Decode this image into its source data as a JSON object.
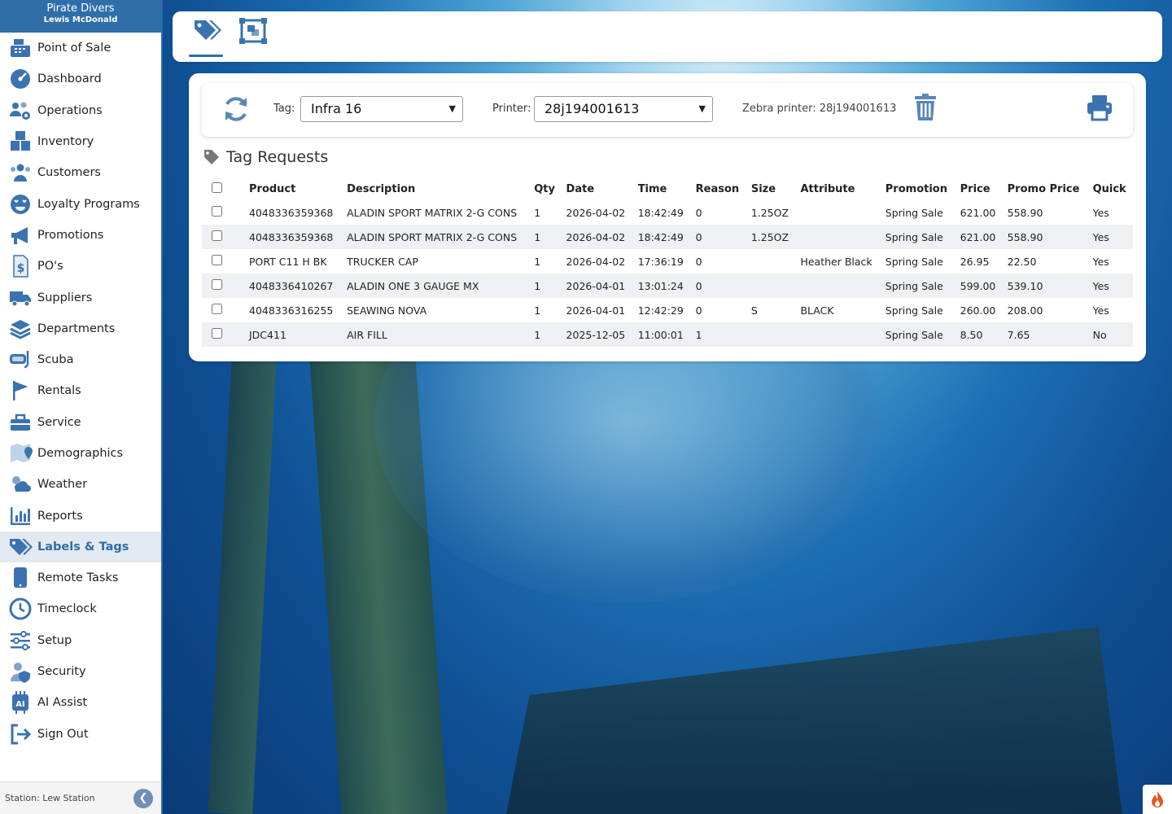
{
  "header": {
    "store": "Pirate Divers",
    "user": "Lewis McDonald"
  },
  "sidebar": {
    "items": [
      {
        "label": "Point of Sale",
        "icon": "cash-register-icon"
      },
      {
        "label": "Dashboard",
        "icon": "gauge-icon"
      },
      {
        "label": "Operations",
        "icon": "users-gear-icon"
      },
      {
        "label": "Inventory",
        "icon": "boxes-icon"
      },
      {
        "label": "Customers",
        "icon": "users-icon"
      },
      {
        "label": "Loyalty Programs",
        "icon": "loyalty-face-icon"
      },
      {
        "label": "Promotions",
        "icon": "megaphone-icon"
      },
      {
        "label": "PO's",
        "icon": "invoice-dollar-icon"
      },
      {
        "label": "Suppliers",
        "icon": "truck-icon"
      },
      {
        "label": "Departments",
        "icon": "layers-icon"
      },
      {
        "label": "Scuba",
        "icon": "mask-icon"
      },
      {
        "label": "Rentals",
        "icon": "flag-icon"
      },
      {
        "label": "Service",
        "icon": "toolbox-icon"
      },
      {
        "label": "Demographics",
        "icon": "map-pin-icon"
      },
      {
        "label": "Weather",
        "icon": "cloud-sun-icon"
      },
      {
        "label": "Reports",
        "icon": "bar-chart-icon"
      },
      {
        "label": "Labels & Tags",
        "icon": "tags-icon",
        "active": true
      },
      {
        "label": "Remote Tasks",
        "icon": "tablet-icon"
      },
      {
        "label": "Timeclock",
        "icon": "clock-icon"
      },
      {
        "label": "Setup",
        "icon": "sliders-icon"
      },
      {
        "label": "Security",
        "icon": "user-shield-icon"
      },
      {
        "label": "AI Assist",
        "icon": "ai-chip-icon"
      },
      {
        "label": "Sign Out",
        "icon": "sign-out-icon"
      }
    ],
    "station": "Station: Lew Station"
  },
  "toolbar": {
    "tabs": [
      {
        "icon": "tag-icon",
        "active": true
      },
      {
        "icon": "label-layout-icon"
      }
    ]
  },
  "controls": {
    "tag_label": "Tag:",
    "tag_value": "Infra 16",
    "printer_label": "Printer:",
    "printer_value": "28j194001613",
    "zebra_text": "Zebra printer: 28j194001613"
  },
  "section": {
    "title": "Tag Requests"
  },
  "table": {
    "columns": [
      "Product",
      "Description",
      "Qty",
      "Date",
      "Time",
      "Reason",
      "Size",
      "Attribute",
      "Promotion",
      "Price",
      "Promo Price",
      "Quick"
    ],
    "rows": [
      [
        "4048336359368",
        "ALADIN SPORT MATRIX 2-G CONS",
        "1",
        "2026-04-02",
        "18:42:49",
        "0",
        "1.25OZ",
        "",
        "Spring Sale",
        "621.00",
        "558.90",
        "Yes"
      ],
      [
        "4048336359368",
        "ALADIN SPORT MATRIX 2-G CONS",
        "1",
        "2026-04-02",
        "18:42:49",
        "0",
        "1.25OZ",
        "",
        "Spring Sale",
        "621.00",
        "558.90",
        "Yes"
      ],
      [
        "PORT C11 H BK",
        "TRUCKER CAP",
        "1",
        "2026-04-02",
        "17:36:19",
        "0",
        "",
        "Heather Black",
        "Spring Sale",
        "26.95",
        "22.50",
        "Yes"
      ],
      [
        "4048336410267",
        "ALADIN ONE 3 GAUGE MX",
        "1",
        "2026-04-01",
        "13:01:24",
        "0",
        "",
        "",
        "Spring Sale",
        "599.00",
        "539.10",
        "Yes"
      ],
      [
        "4048336316255",
        "SEAWING NOVA",
        "1",
        "2026-04-01",
        "12:42:29",
        "0",
        "S",
        "BLACK",
        "Spring Sale",
        "260.00",
        "208.00",
        "Yes"
      ],
      [
        "JDC411",
        "AIR FILL",
        "1",
        "2025-12-05",
        "11:00:01",
        "1",
        "",
        "",
        "Spring Sale",
        "8.50",
        "7.65",
        "No"
      ]
    ]
  },
  "colors": {
    "accent": "#2f6ea8",
    "icon": "#3b73b0",
    "row_alt": "#eef0f3"
  }
}
